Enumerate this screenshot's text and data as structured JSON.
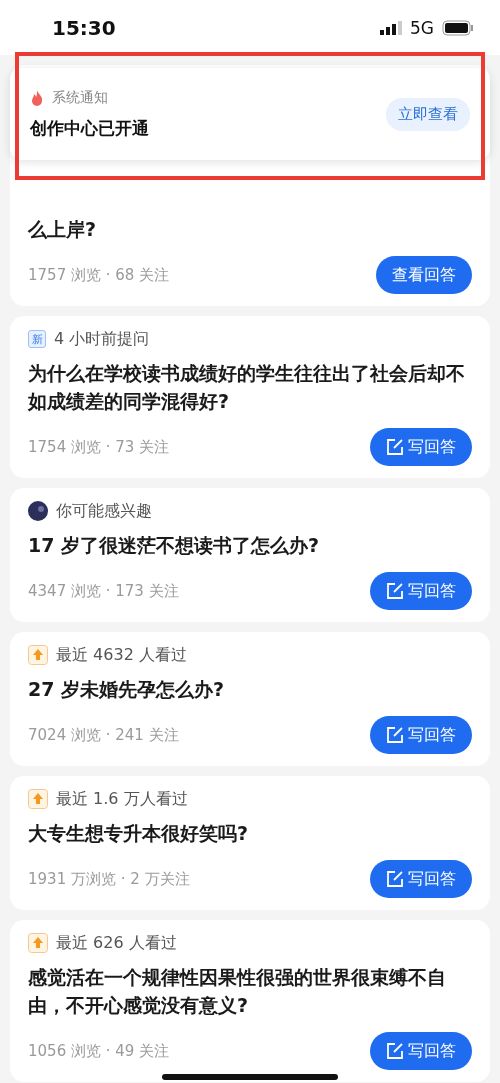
{
  "status_bar": {
    "time": "15:30",
    "network": "5G"
  },
  "notification": {
    "source": "系统通知",
    "message": "创作中心已开通",
    "button": "立即查看",
    "highlighted": true
  },
  "questions": [
    {
      "question": "么上岸?",
      "meta": "1757 浏览 · 68 关注",
      "button": {
        "kind": "view",
        "label": "查看回答"
      }
    },
    {
      "tag": {
        "kind": "new",
        "badge": "新"
      },
      "label": "4 小时前提问",
      "question": "为什么在学校读书成绩好的学生往往出了社会后却不如成绩差的同学混得好?",
      "meta": "1754 浏览 · 73 关注",
      "button": {
        "kind": "write",
        "label": "写回答"
      }
    },
    {
      "tag": {
        "kind": "avatar"
      },
      "label": "你可能感兴趣",
      "question": "17 岁了很迷茫不想读书了怎么办?",
      "meta": "4347 浏览 · 173 关注",
      "button": {
        "kind": "write",
        "label": "写回答"
      }
    },
    {
      "tag": {
        "kind": "hot"
      },
      "label": "最近 4632 人看过",
      "question": "27 岁未婚先孕怎么办?",
      "meta": "7024 浏览 · 241 关注",
      "button": {
        "kind": "write",
        "label": "写回答"
      }
    },
    {
      "tag": {
        "kind": "hot"
      },
      "label": "最近 1.6 万人看过",
      "question": "大专生想专升本很好笑吗?",
      "meta": "1931 万浏览 · 2 万关注",
      "button": {
        "kind": "write",
        "label": "写回答"
      }
    },
    {
      "tag": {
        "kind": "hot"
      },
      "label": "最近 626 人看过",
      "question": "感觉活在一个规律性因果性很强的世界很束缚不自由，不开心感觉没有意义?",
      "meta": "1056 浏览 · 49 关注",
      "button": {
        "kind": "write",
        "label": "写回答"
      }
    }
  ]
}
